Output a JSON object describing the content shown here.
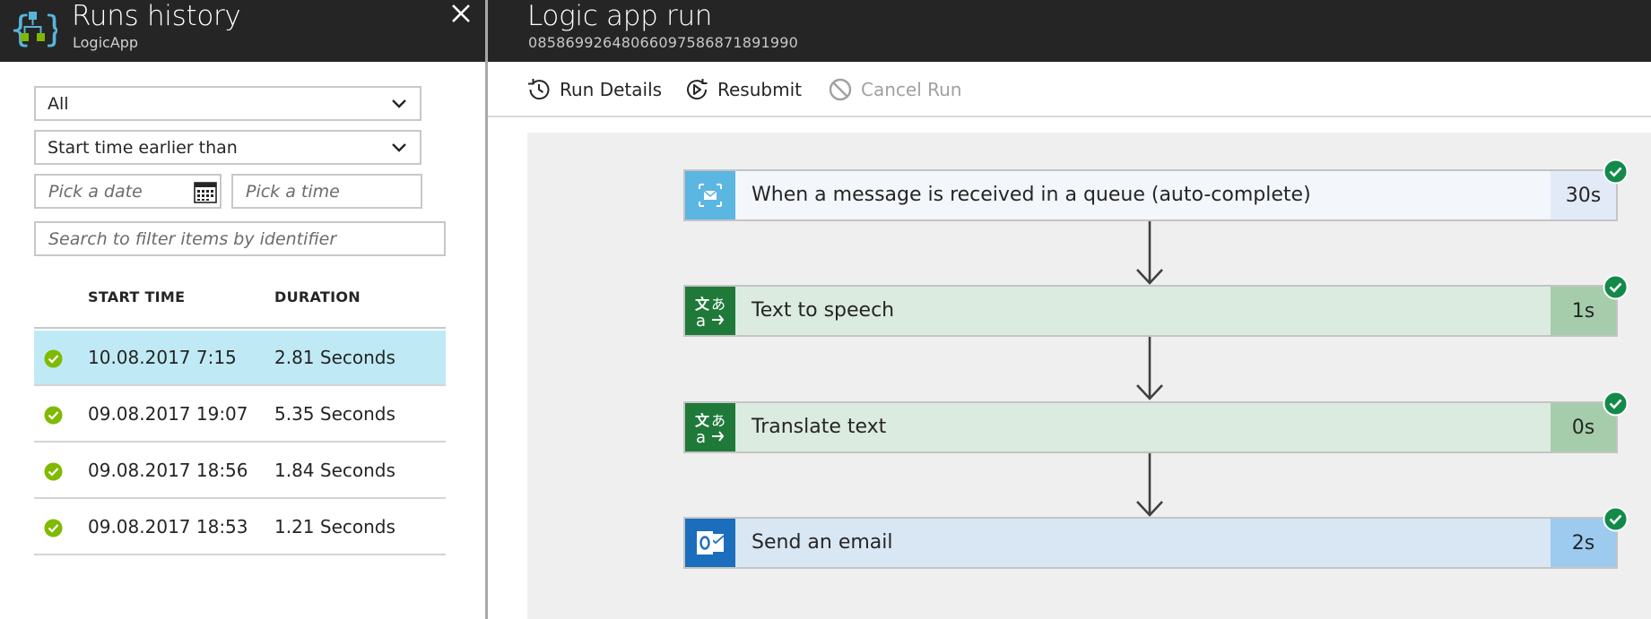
{
  "left_blade": {
    "title": "Runs history",
    "subtitle": "LogicApp",
    "filters": {
      "status_selected": "All",
      "time_selected": "Start time earlier than",
      "date_placeholder": "Pick a date",
      "time_placeholder": "Pick a time",
      "search_placeholder": "Search to filter items by identifier"
    },
    "table": {
      "columns": [
        "START TIME",
        "DURATION"
      ],
      "rows": [
        {
          "start_time": "10.08.2017 7:15",
          "duration": "2.81 Seconds",
          "status": "succeeded",
          "selected": true
        },
        {
          "start_time": "09.08.2017 19:07",
          "duration": "5.35 Seconds",
          "status": "succeeded",
          "selected": false
        },
        {
          "start_time": "09.08.2017 18:56",
          "duration": "1.84 Seconds",
          "status": "succeeded",
          "selected": false
        },
        {
          "start_time": "09.08.2017 18:53",
          "duration": "1.21 Seconds",
          "status": "succeeded",
          "selected": false
        }
      ]
    }
  },
  "right_blade": {
    "title": "Logic app run",
    "run_id": "08586992648066097586871891990",
    "toolbar": {
      "run_details": "Run Details",
      "resubmit": "Resubmit",
      "cancel_run": "Cancel Run"
    },
    "steps": [
      {
        "label": "When a message is received in a queue (auto-complete)",
        "duration": "30s",
        "icon": "service-bus-icon",
        "status": "succeeded"
      },
      {
        "label": "Text to speech",
        "duration": "1s",
        "icon": "translator-icon",
        "status": "succeeded"
      },
      {
        "label": "Translate text",
        "duration": "0s",
        "icon": "translator-icon",
        "status": "succeeded"
      },
      {
        "label": "Send an email",
        "duration": "2s",
        "icon": "outlook-icon",
        "status": "succeeded"
      }
    ]
  },
  "colors": {
    "header_bg": "#252525",
    "selected_row": "#bfeaf5",
    "success_green": "#7fba00",
    "step_check_green": "#138a4a",
    "trigger_icon": "#5bb6e2",
    "translator_icon": "#1f7a39",
    "outlook_icon": "#1a6ebc"
  }
}
